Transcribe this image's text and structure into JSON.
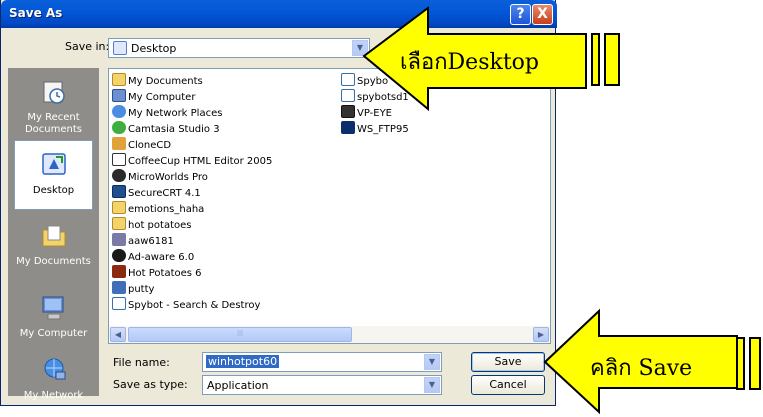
{
  "dialog": {
    "title": "Save As",
    "help_label": "?",
    "close_label": "X"
  },
  "save_in": {
    "label": "Save in:",
    "value": "Desktop"
  },
  "places": [
    {
      "label": "My Recent Documents",
      "icon": "recent-documents-icon",
      "selected": false
    },
    {
      "label": "Desktop",
      "icon": "desktop-icon",
      "selected": true
    },
    {
      "label": "My Documents",
      "icon": "my-documents-icon",
      "selected": false
    },
    {
      "label": "My Computer",
      "icon": "my-computer-icon",
      "selected": false
    },
    {
      "label": "My Network",
      "icon": "network-icon",
      "selected": false
    }
  ],
  "files": [
    {
      "name": "My Documents",
      "icon": "folder-documents-icon"
    },
    {
      "name": "My Computer",
      "icon": "computer-icon"
    },
    {
      "name": "My Network Places",
      "icon": "network-places-icon"
    },
    {
      "name": "Camtasia Studio 3",
      "icon": "camtasia-icon"
    },
    {
      "name": "CloneCD",
      "icon": "clonecd-icon"
    },
    {
      "name": "CoffeeCup HTML Editor 2005",
      "icon": "coffeecup-icon"
    },
    {
      "name": "MicroWorlds Pro",
      "icon": "microworlds-icon"
    },
    {
      "name": "SecureCRT 4.1",
      "icon": "securecrt-icon"
    },
    {
      "name": "emotions_haha",
      "icon": "folder-icon"
    },
    {
      "name": "hot potatoes",
      "icon": "folder-icon"
    },
    {
      "name": "aaw6181",
      "icon": "app-icon"
    },
    {
      "name": "Ad-aware 6.0",
      "icon": "adaware-icon"
    },
    {
      "name": "Hot Potatoes 6",
      "icon": "hotpotatoes-icon"
    },
    {
      "name": "putty",
      "icon": "putty-icon"
    },
    {
      "name": "Spybot - Search & Destroy",
      "icon": "spybot-icon"
    },
    {
      "name": "Spybo",
      "icon": "spybot-icon"
    },
    {
      "name": "spybotsd1",
      "icon": "spybot-icon"
    },
    {
      "name": "VP-EYE",
      "icon": "vp-eye-icon"
    },
    {
      "name": "WS_FTP95",
      "icon": "wsftp-icon"
    }
  ],
  "file_name": {
    "label": "File name:",
    "value": "winhotpot60"
  },
  "save_as_type": {
    "label": "Save as type:",
    "value": "Application"
  },
  "buttons": {
    "save": "Save",
    "cancel": "Cancel"
  },
  "callouts": {
    "desktop": "เลือกDesktop",
    "save": "คลิก Save"
  },
  "colors": {
    "callout_fill": "#ffff00",
    "title_bar": "#0358d7",
    "dialog_bg": "#ece9d8"
  }
}
